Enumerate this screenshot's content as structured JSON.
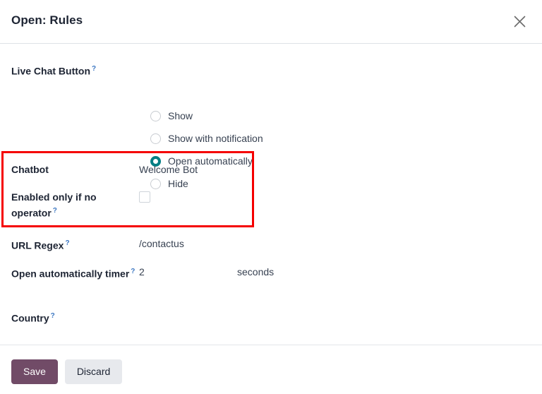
{
  "header": {
    "title": "Open: Rules",
    "close_icon": "close-icon"
  },
  "form": {
    "live_chat_button": {
      "label": "Live Chat Button",
      "help": "?",
      "options": [
        {
          "label": "Show",
          "selected": false
        },
        {
          "label": "Show with notification",
          "selected": false
        },
        {
          "label": "Open automatically",
          "selected": true
        },
        {
          "label": "Hide",
          "selected": false
        }
      ]
    },
    "chatbot": {
      "label": "Chatbot",
      "value": "Welcome Bot"
    },
    "enabled_only_if_no_operator": {
      "label": "Enabled only if no operator",
      "help": "?",
      "checked": false
    },
    "url_regex": {
      "label": "URL Regex",
      "help": "?",
      "value": "/contactus"
    },
    "open_automatically_timer": {
      "label": "Open automatically timer",
      "help": "?",
      "value": "2",
      "unit": "seconds"
    },
    "country": {
      "label": "Country",
      "help": "?",
      "value": ""
    }
  },
  "footer": {
    "save_label": "Save",
    "discard_label": "Discard"
  },
  "annotation": {
    "highlight_color": "#f50000"
  },
  "colors": {
    "accent_teal": "#017e84",
    "brand_purple": "#714b67",
    "help_blue": "#3c77c2",
    "text_dark": "#1d2433"
  }
}
